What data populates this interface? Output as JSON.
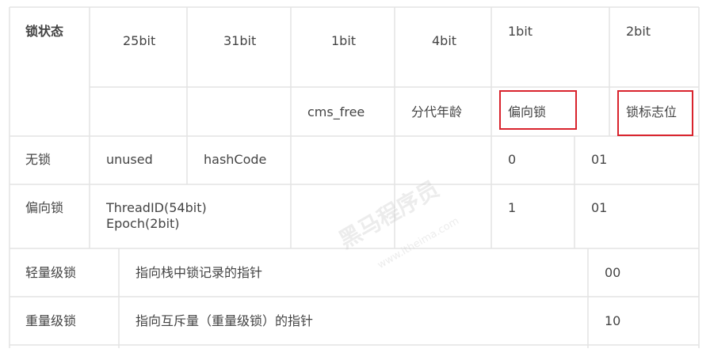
{
  "header": {
    "state_label": "锁状态",
    "bits": [
      "25bit",
      "31bit",
      "1bit",
      "4bit",
      "1bit",
      "2bit"
    ],
    "sub_labels": [
      "cms_free",
      "分代年龄",
      "偏向锁",
      "锁标志位"
    ]
  },
  "rows": {
    "lock_free": {
      "state": "无锁",
      "unused": "unused",
      "hash": "hashCode",
      "biased": "0",
      "flag": "01"
    },
    "biased": {
      "state": "偏向锁",
      "thread_line1": "ThreadID(54bit)",
      "thread_line2": "Epoch(2bit)",
      "biased": "1",
      "flag": "01"
    },
    "lightweight": {
      "state": "轻量级锁",
      "desc": "指向栈中锁记录的指针",
      "flag": "00"
    },
    "heavyweight": {
      "state": "重量级锁",
      "desc": "指向互斥量（重量级锁）的指针",
      "flag": "10"
    }
  },
  "watermark": {
    "brand": "黑马程序员",
    "site": "www.itheima.com"
  },
  "colors": {
    "grid": "#e3e3e3",
    "highlight": "#d9232d",
    "text": "#444444"
  }
}
